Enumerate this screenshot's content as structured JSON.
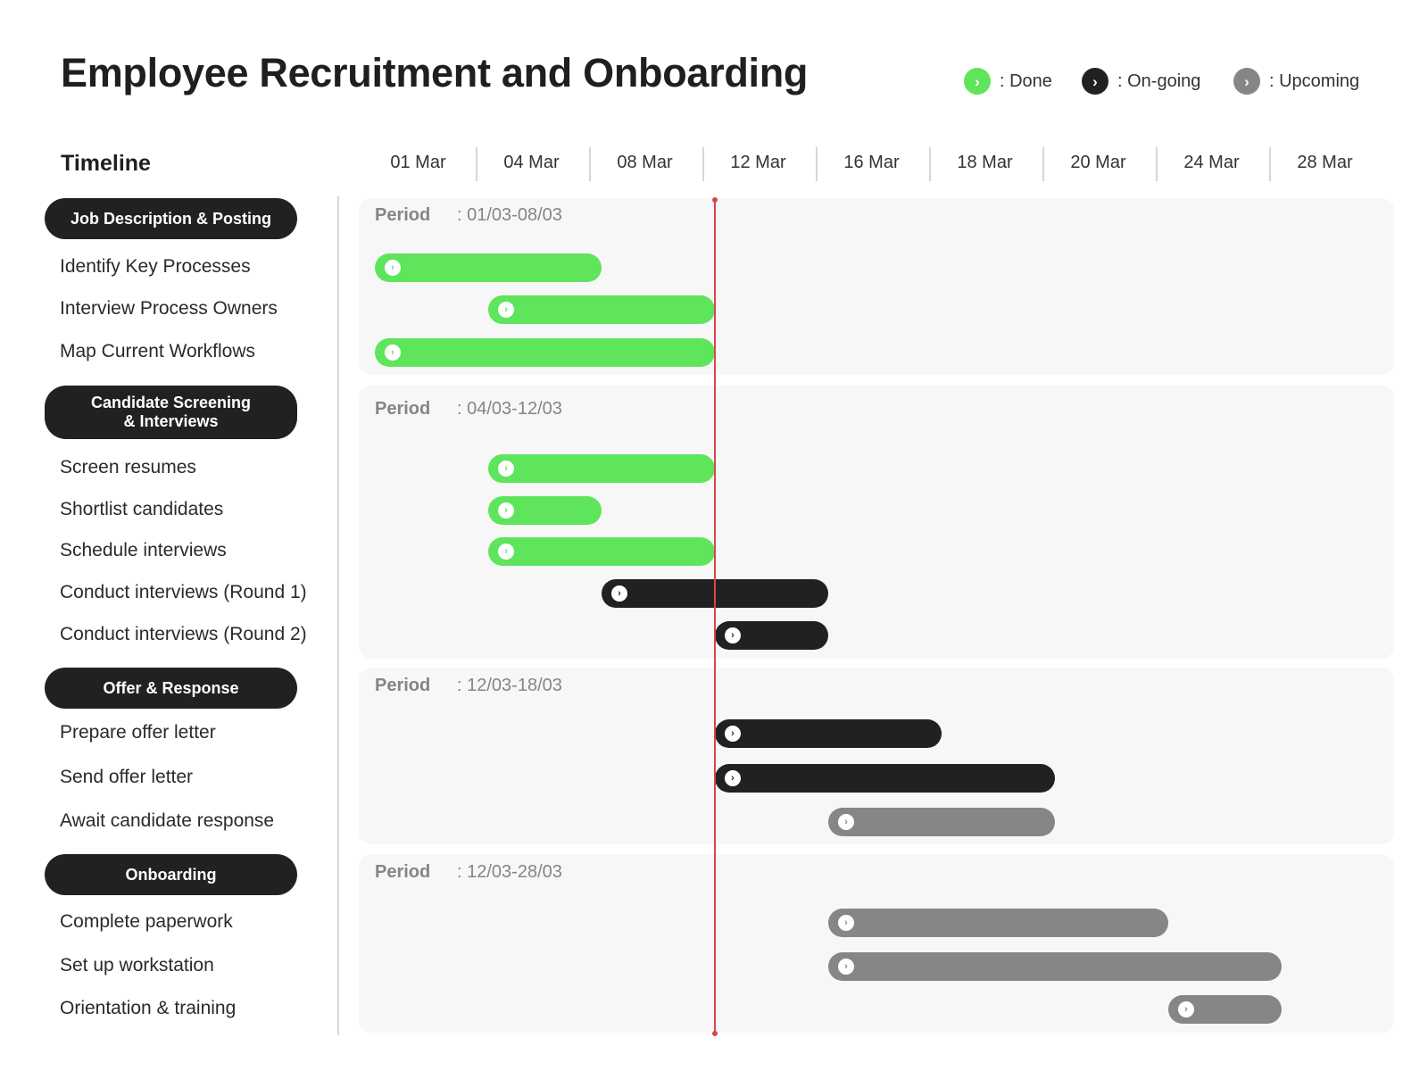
{
  "title": "Employee Recruitment and Onboarding",
  "legend": [
    {
      "label": ": Done",
      "status": "done",
      "icon": "chevron-right-icon"
    },
    {
      "label": ": On-going",
      "status": "ongoing",
      "icon": "chevron-right-icon"
    },
    {
      "label": ": Upcoming",
      "status": "upcoming",
      "icon": "chevron-right-icon"
    }
  ],
  "colors": {
    "done": "#5ee55c",
    "ongoing": "#232023",
    "upcoming": "#868686",
    "today_line": "#d9454b"
  },
  "timeline_label": "Timeline",
  "period_key": "Period",
  "chart_data": {
    "type": "gantt",
    "title": "Employee Recruitment and Onboarding",
    "x_tick_labels": [
      "01 Mar",
      "04 Mar",
      "08 Mar",
      "12 Mar",
      "16 Mar",
      "18 Mar",
      "20 Mar",
      "24 Mar",
      "28 Mar"
    ],
    "today_marker": "12 Mar",
    "groups": [
      {
        "name": "Job Description & Posting",
        "period": ": 01/03-08/03",
        "tasks": [
          {
            "name": "Identify Key Processes",
            "start": "01 Mar",
            "end": "08 Mar",
            "status": "done"
          },
          {
            "name": "Interview Process Owners",
            "start": "04 Mar",
            "end": "12 Mar",
            "status": "done"
          },
          {
            "name": "Map Current Workflows",
            "start": "01 Mar",
            "end": "12 Mar",
            "status": "done"
          }
        ]
      },
      {
        "name": "Candidate Screening\n& Interviews",
        "period": ": 04/03-12/03",
        "tasks": [
          {
            "name": "Screen resumes",
            "start": "04 Mar",
            "end": "12 Mar",
            "status": "done"
          },
          {
            "name": "Shortlist candidates",
            "start": "04 Mar",
            "end": "08 Mar",
            "status": "done"
          },
          {
            "name": "Schedule interviews",
            "start": "04 Mar",
            "end": "12 Mar",
            "status": "done"
          },
          {
            "name": "Conduct interviews (Round 1)",
            "start": "08 Mar",
            "end": "16 Mar",
            "status": "ongoing"
          },
          {
            "name": "Conduct interviews (Round 2)",
            "start": "12 Mar",
            "end": "16 Mar",
            "status": "ongoing"
          }
        ]
      },
      {
        "name": "Offer & Response",
        "period": ": 12/03-18/03",
        "tasks": [
          {
            "name": "Prepare offer letter",
            "start": "12 Mar",
            "end": "18 Mar",
            "status": "ongoing"
          },
          {
            "name": "Send offer letter",
            "start": "12 Mar",
            "end": "20 Mar",
            "status": "ongoing"
          },
          {
            "name": "Await candidate response",
            "start": "16 Mar",
            "end": "20 Mar",
            "status": "upcoming"
          }
        ]
      },
      {
        "name": "Onboarding",
        "period": ": 12/03-28/03",
        "tasks": [
          {
            "name": "Complete paperwork",
            "start": "16 Mar",
            "end": "24 Mar",
            "status": "upcoming"
          },
          {
            "name": "Set up workstation",
            "start": "16 Mar",
            "end": "28 Mar",
            "status": "upcoming"
          },
          {
            "name": "Orientation & training",
            "start": "24 Mar",
            "end": "28 Mar",
            "status": "upcoming"
          }
        ]
      }
    ]
  }
}
